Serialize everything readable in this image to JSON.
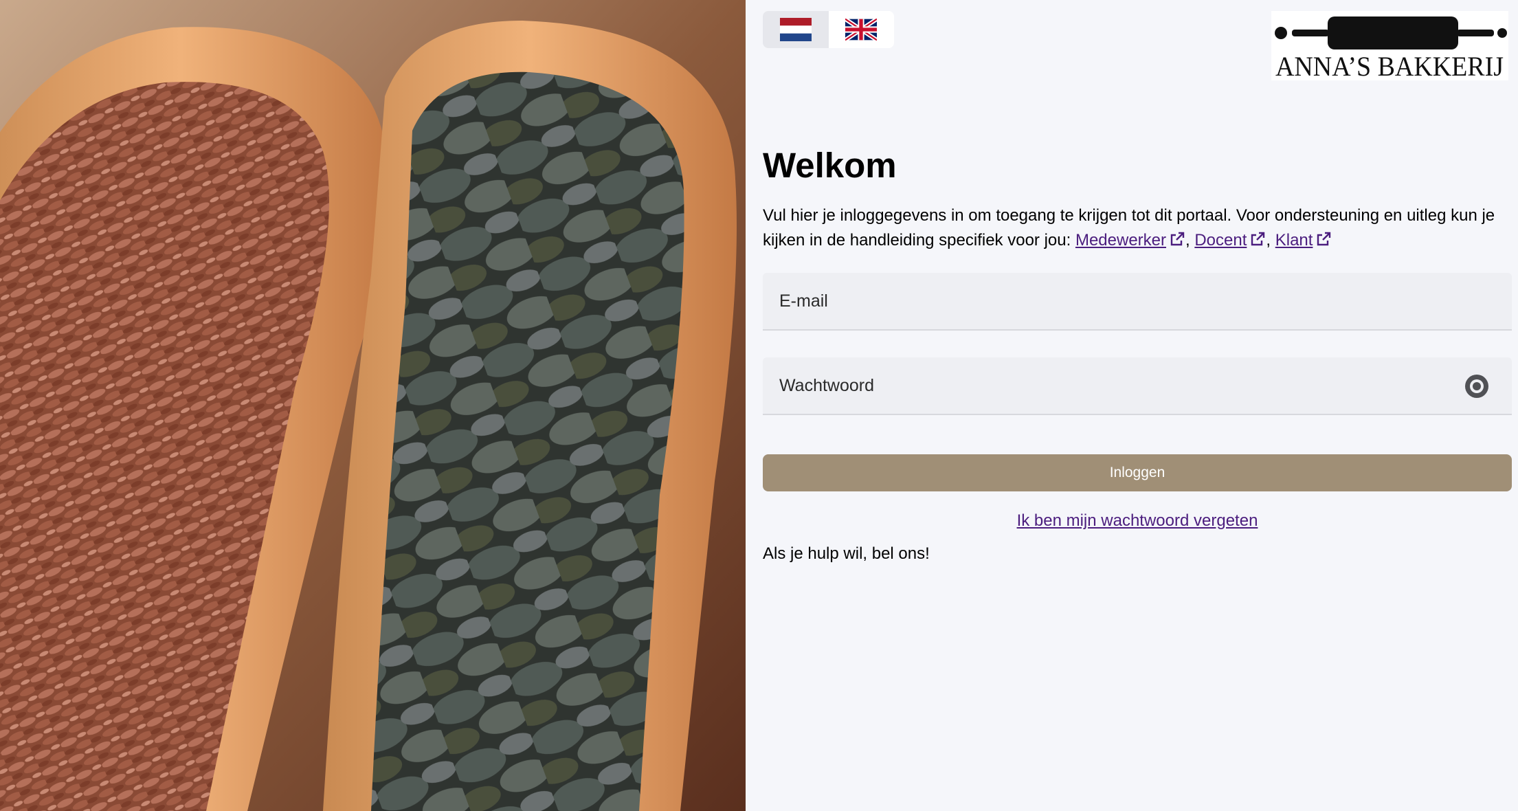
{
  "languages": [
    {
      "code": "nl",
      "label": "Nederlands",
      "active": true
    },
    {
      "code": "en",
      "label": "English",
      "active": false
    }
  ],
  "logo": {
    "brand": "ANNA’S BAKKERIJ"
  },
  "welcome": {
    "title": "Welkom",
    "intro_text": "Vul hier je inloggegevens in om toegang te krijgen tot dit portaal. Voor ondersteuning en uitleg kun je kijken in de handleiding specifiek voor jou: ",
    "links": [
      {
        "label": "Medewerker"
      },
      {
        "label": "Docent"
      },
      {
        "label": "Klant"
      }
    ],
    "separator": ", "
  },
  "form": {
    "email_placeholder": "E-mail",
    "password_placeholder": "Wachtwoord",
    "login_label": "Inloggen",
    "forgot_label": "Ik ben mijn wachtwoord vergeten"
  },
  "help_text": "Als je hulp wil, bel ons!",
  "colors": {
    "background": "#f5f6fa",
    "button": "#a08f76",
    "link": "#4b1d7e",
    "field": "#eeeff3"
  },
  "icons": [
    "flag-nl-icon",
    "flag-uk-icon",
    "external-link-icon",
    "eye-icon"
  ]
}
